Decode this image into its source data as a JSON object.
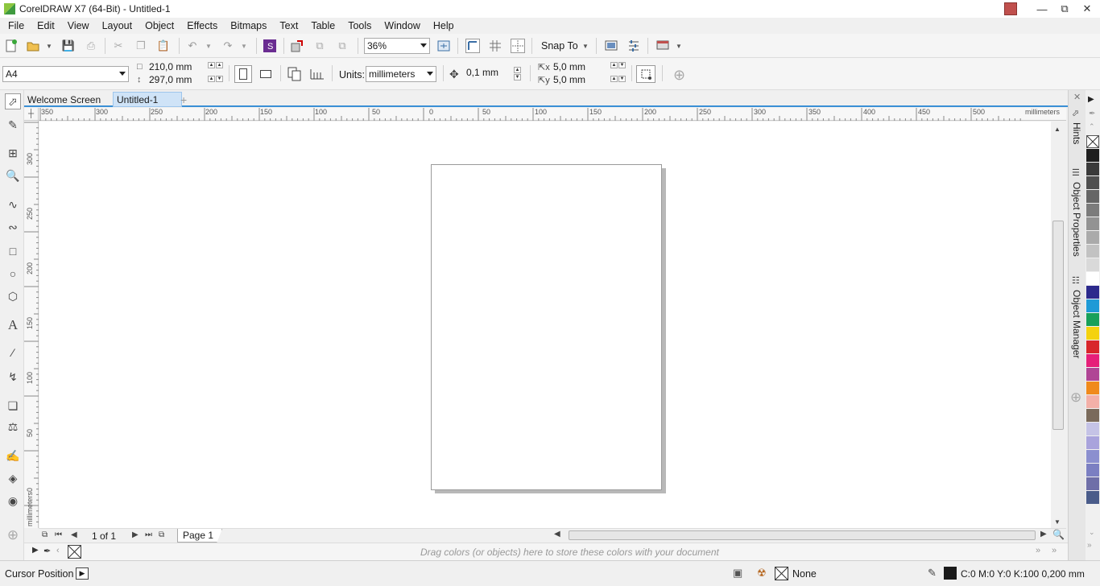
{
  "window": {
    "title": "CorelDRAW X7 (64-Bit) - Untitled-1"
  },
  "menu": [
    "File",
    "Edit",
    "View",
    "Layout",
    "Object",
    "Effects",
    "Bitmaps",
    "Text",
    "Table",
    "Tools",
    "Window",
    "Help"
  ],
  "toolbar": {
    "zoom_value": "36%",
    "snap_label": "Snap To"
  },
  "propbar": {
    "page_size": "A4",
    "width": "210,0 mm",
    "height": "297,0 mm",
    "units_label": "Units:",
    "units_value": "millimeters",
    "nudge": "0,1 mm",
    "dup_x": "5,0 mm",
    "dup_y": "5,0 mm"
  },
  "tabs": [
    "Welcome Screen",
    "Untitled-1"
  ],
  "ruler": {
    "h_labels": [
      "350",
      "300",
      "250",
      "200",
      "150",
      "100",
      "50",
      "0",
      "50",
      "100",
      "150",
      "200",
      "250",
      "300",
      "350",
      "400",
      "450",
      "500"
    ],
    "h_unit": "millimeters",
    "v_labels": [
      "300",
      "250",
      "200",
      "150",
      "100",
      "50",
      "0"
    ],
    "v_unit": "millimeters"
  },
  "docker": {
    "tabs": [
      "Hints",
      "Object Properties",
      "Object Manager"
    ]
  },
  "palette": {
    "colors": [
      "#1f1f1f",
      "#3a3a3a",
      "#4f4f4f",
      "#666666",
      "#7c7c7c",
      "#939393",
      "#aaaaaa",
      "#c2c2c2",
      "#d9d9d9",
      "#ffffff",
      "#2c2a8c",
      "#1f9ad6",
      "#18a05a",
      "#f4d20f",
      "#d8262b",
      "#e61f79",
      "#b04595",
      "#f08a1c",
      "#f3b0a8",
      "#7a6a5b",
      "#c5c3e6",
      "#a9a3dc",
      "#8b8fcf",
      "#7b7fc2",
      "#6f6fa8",
      "#4a5c8a"
    ]
  },
  "page_nav": {
    "count": "1 of 1",
    "page_tab": "Page 1"
  },
  "doc_palette_hint": "Drag colors (or objects) here to store these colors with your document",
  "status": {
    "cursor_label": "Cursor Position",
    "fill": "None",
    "outline": "C:0 M:0 Y:0 K:100  0,200 mm"
  }
}
